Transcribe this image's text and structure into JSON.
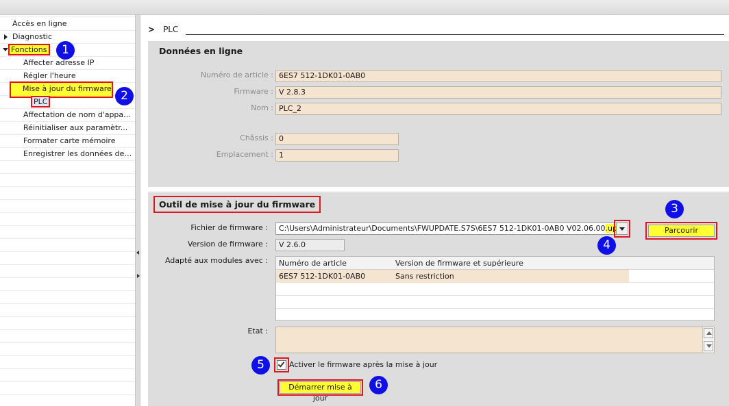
{
  "nav": {
    "items": [
      {
        "label": "Accès en ligne"
      },
      {
        "label": "Diagnostic"
      },
      {
        "label": "Fonctions"
      },
      {
        "label": "Affecter adresse IP"
      },
      {
        "label": "Régler l'heure"
      },
      {
        "label": "Mise à jour du firmware"
      },
      {
        "label": "PLC"
      },
      {
        "label": "Affectation de nom d'appar..."
      },
      {
        "label": "Réinitialiser aux paramètr..."
      },
      {
        "label": "Formater carte mémoire"
      },
      {
        "label": "Enregistrer les données de ..."
      }
    ]
  },
  "breadcrumb": {
    "chevron": ">",
    "label": "PLC"
  },
  "online_data": {
    "title": "Données en ligne",
    "fields": [
      {
        "label": "Numéro de article :",
        "value": "6ES7 512-1DK01-0AB0"
      },
      {
        "label": "Firmware :",
        "value": "V 2.8.3"
      },
      {
        "label": "Nom :",
        "value": "PLC_2"
      },
      {
        "label": "Châssis :",
        "value": "0"
      },
      {
        "label": "Emplacement :",
        "value": "1"
      }
    ]
  },
  "fw_tool": {
    "title": "Outil de mise à jour du firmware",
    "file_label": "Fichier de firmware :",
    "file_path": "C:\\Users\\Administrateur\\Documents\\FWUPDATE.S7S\\6ES7 512-1DK01-0AB0 V02.06.00",
    "file_ext": ".upd",
    "browse_label": "Parcourir",
    "version_label": "Version de firmware :",
    "version_value": "V 2.6.0",
    "modules_label": "Adapté aux modules avec :",
    "table": {
      "headers": [
        "Numéro de article",
        "Version de firmware et supérieure"
      ],
      "rows": [
        [
          "6ES7 512-1DK01-0AB0",
          "Sans restriction"
        ]
      ]
    },
    "state_label": "Etat :",
    "activate_label": "Activer le firmware après la mise à  jour",
    "activate_checked": true,
    "start_label": "Démarrer mise à jour"
  },
  "badges": [
    "1",
    "2",
    "3",
    "4",
    "5",
    "6"
  ],
  "colors": {
    "highlight": "#ffff33",
    "annotation": "#e0141e",
    "badge": "#1010e6",
    "field": "#f4e4d0",
    "panel": "#dddddd"
  }
}
